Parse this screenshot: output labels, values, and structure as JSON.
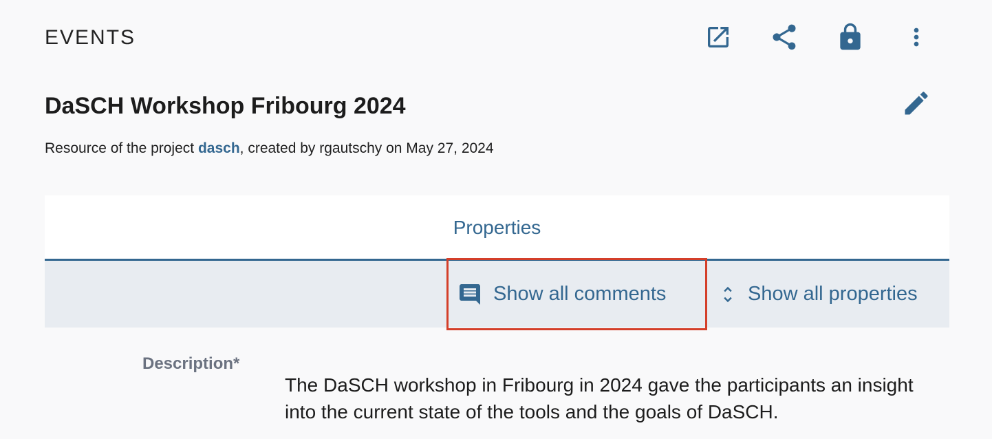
{
  "header": {
    "class_label": "EVENTS",
    "actions": [
      {
        "name": "open-in-new-tab-icon"
      },
      {
        "name": "share-icon"
      },
      {
        "name": "lock-icon"
      },
      {
        "name": "more-vert-icon"
      }
    ]
  },
  "resource": {
    "title": "DaSCH Workshop Fribourg 2024",
    "info_prefix": "Resource of the project ",
    "project": "dasch",
    "info_suffix": ", created by rgautschy on May 27, 2024",
    "edit_icon": "pencil-icon"
  },
  "tabs": {
    "active_label": "Properties"
  },
  "toolbar": {
    "show_comments_label": "Show all comments",
    "show_comments_icon": "comment-icon",
    "show_properties_label": "Show all properties",
    "show_properties_icon": "unfold-more-icon"
  },
  "properties": [
    {
      "label": "Description*",
      "value": "The DaSCH workshop in Fribourg in 2024 gave the participants an insight into the current state of the tools and the goals of DaSCH."
    }
  ],
  "colors": {
    "accent": "#336790",
    "toolbar_bg": "#e8ecf1",
    "highlight": "#d43f2a"
  }
}
